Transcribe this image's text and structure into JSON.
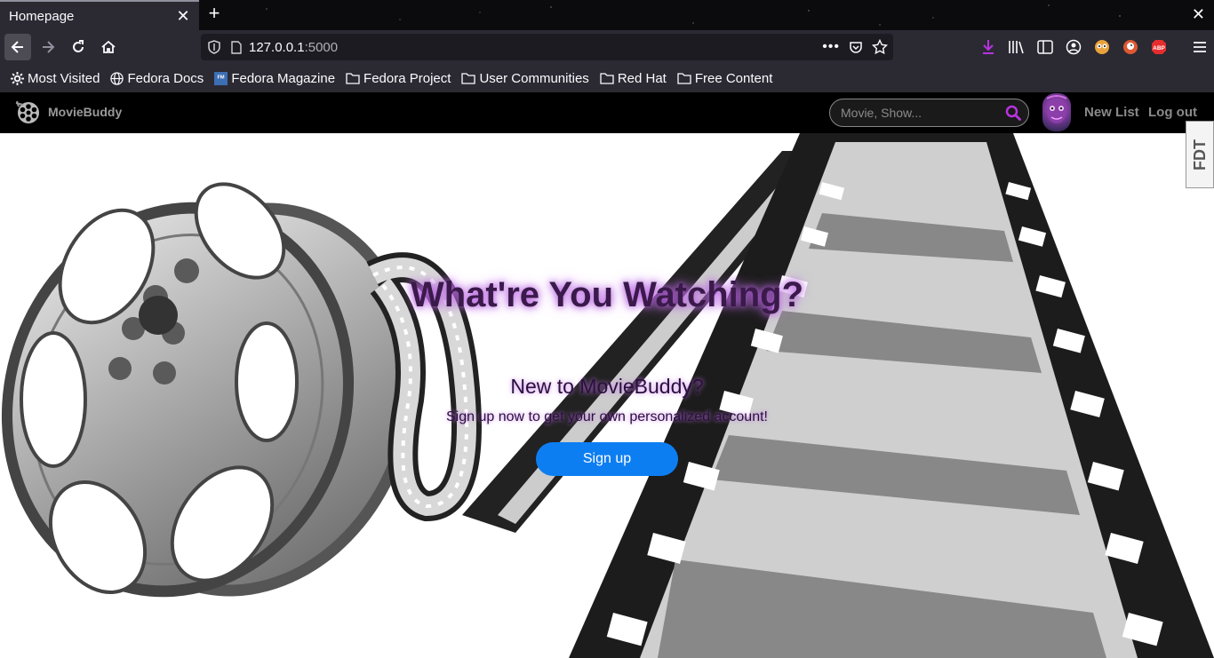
{
  "browser": {
    "tab_title": "Homepage",
    "url_host": "127.0.0.1",
    "url_port": ":5000",
    "accent_color": "#b833e1"
  },
  "bookmarks": [
    {
      "label": "Most Visited",
      "icon": "gear-icon"
    },
    {
      "label": "Fedora Docs",
      "icon": "globe-icon"
    },
    {
      "label": "Fedora Magazine",
      "icon": "fm-icon"
    },
    {
      "label": "Fedora Project",
      "icon": "folder-icon"
    },
    {
      "label": "User Communities",
      "icon": "folder-icon"
    },
    {
      "label": "Red Hat",
      "icon": "folder-icon"
    },
    {
      "label": "Free Content",
      "icon": "folder-icon"
    }
  ],
  "site": {
    "brand": "MovieBuddy",
    "search_placeholder": "Movie, Show...",
    "new_list": "New List",
    "log_out": "Log out"
  },
  "hero": {
    "title": "What're You Watching?",
    "subtitle": "New to MovieBuddy?",
    "text": "Sign up now to get your own personalized account!",
    "signup_label": "Sign up",
    "button_color": "#0d7ef2"
  },
  "extension_tab": "FDT"
}
